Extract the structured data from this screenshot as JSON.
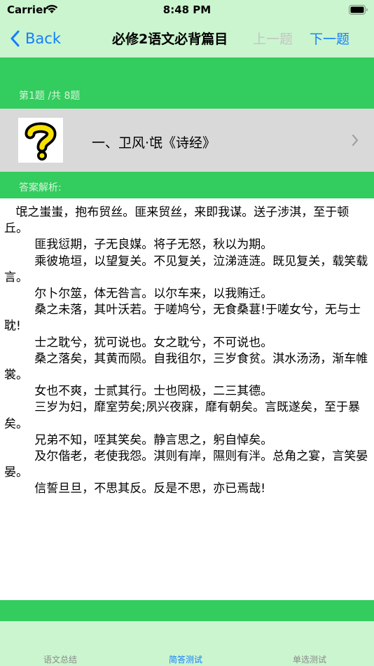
{
  "status_bar": {
    "carrier": "Carrier",
    "time": "8:48 PM"
  },
  "nav": {
    "back_label": "Back",
    "title": "必修2语文必背篇目",
    "prev_label": "上一题",
    "next_label": "下一题"
  },
  "question": {
    "counter": "第1题 /共 8题",
    "title": "一、卫风·氓《诗经》",
    "icon": "question-mark-icon"
  },
  "answer": {
    "label": "答案解析:",
    "text": "   氓之蚩蚩，抱布贸丝。匪来贸丝，来即我谋。送子涉淇，至于顿丘。\n        匪我愆期，子无良媒。将子无怒，秋以为期。\n        乘彼垝垣，以望复关。不见复关，泣涕涟涟。既见复关，载笑载言。\n        尔卜尔筮，体无咎言。以尔车来，以我贿迁。\n        桑之未落，其叶沃若。于嗟鸠兮，无食桑葚!于嗟女兮，无与士耽!\n        士之耽兮，犹可说也。女之耽兮，不可说也。\n        桑之落矣，其黄而陨。自我徂尔，三岁食贫。淇水汤汤，渐车帷裳。\n        女也不爽，士贰其行。士也罔极，二三其德。\n        三岁为妇，靡室劳矣;夙兴夜寐，靡有朝矣。言既遂矣，至于暴矣。\n        兄弟不知，咥其笑矣。静言思之，躬自悼矣。\n        及尔偕老，老使我怨。淇则有岸，隰则有泮。总角之宴，言笑晏晏。\n        信誓旦旦，不思其反。反是不思，亦已焉哉!"
  },
  "tabs": [
    {
      "label": "语文总结",
      "active": false
    },
    {
      "label": "简答测试",
      "active": true
    },
    {
      "label": "单选测试",
      "active": false
    }
  ],
  "colors": {
    "accent_blue": "#147efb",
    "green": "#33cc5e",
    "light_green": "#cbf5cf",
    "gray_row": "#d9d9d9"
  }
}
